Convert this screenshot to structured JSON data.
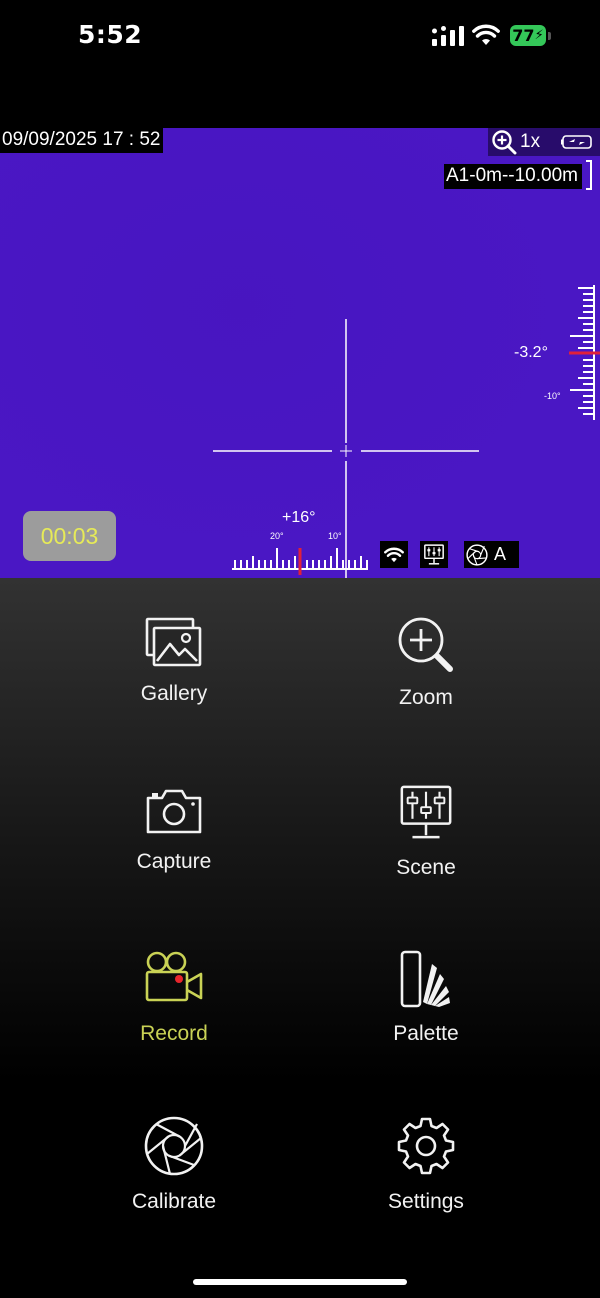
{
  "status_bar": {
    "time": "5:52",
    "battery": "77",
    "icons": [
      "signal-icon",
      "wifi-icon",
      "battery-icon"
    ]
  },
  "viewfinder": {
    "timestamp": "09/09/2025 17 : 52",
    "zoom": "1x",
    "range": "A1-0m--10.00m",
    "elevation": "-3.2°",
    "elevation_scale_label": "-10°",
    "azimuth": "+16°",
    "azimuth_tick_20": "20°",
    "azimuth_tick_10": "10°",
    "recording_time": "00:03",
    "mode_letter": "A",
    "background_color": "#4a17c4"
  },
  "menu": {
    "gallery": "Gallery",
    "zoom": "Zoom",
    "capture": "Capture",
    "scene": "Scene",
    "record": "Record",
    "palette": "Palette",
    "calibrate": "Calibrate",
    "settings": "Settings",
    "active_item": "record",
    "active_color": "#c9d255"
  }
}
